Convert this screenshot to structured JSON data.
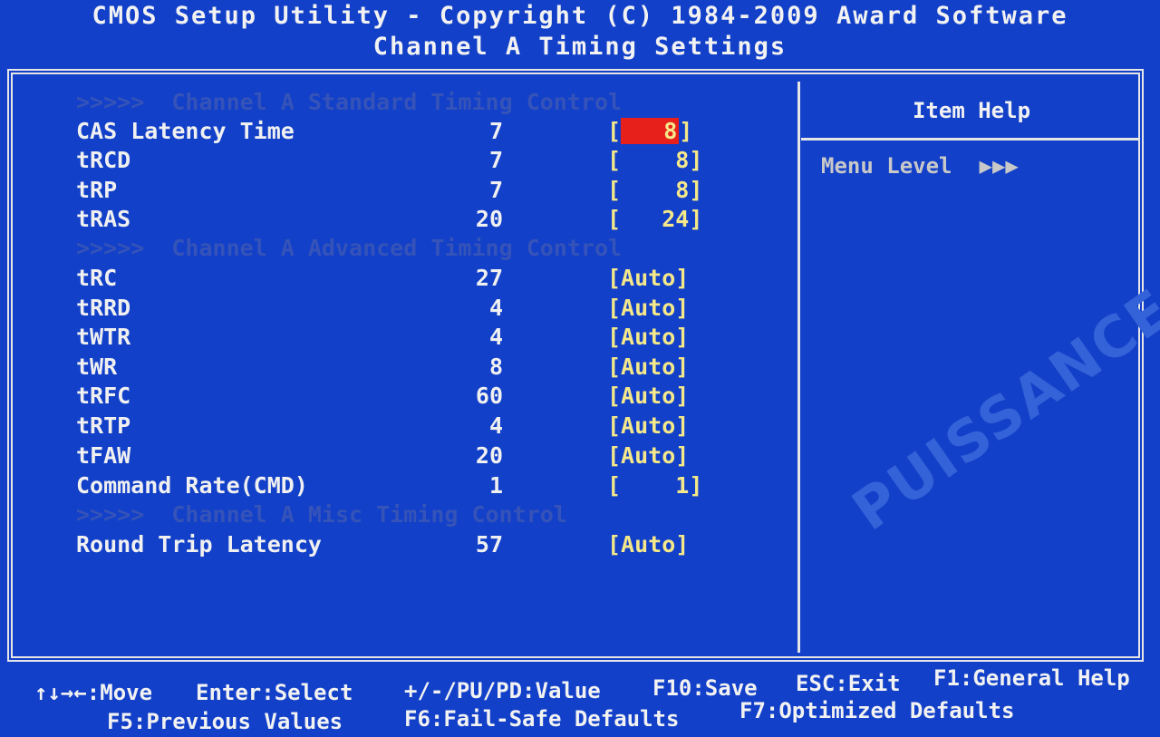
{
  "header": {
    "title": "CMOS Setup Utility - Copyright (C) 1984-2009 Award Software",
    "subtitle": "Channel A Timing Settings"
  },
  "sections": {
    "standard": ">>>>>  Channel A Standard Timing Control",
    "advanced": ">>>>>  Channel A Advanced Timing Control",
    "misc": ">>>>>  Channel A Misc Timing Control"
  },
  "rows": [
    {
      "label": "CAS Latency Time",
      "current": "7",
      "setting": "8",
      "open": "[",
      "close": "]"
    },
    {
      "label": "tRCD",
      "current": "7",
      "setting": "8",
      "open": "[",
      "close": "]"
    },
    {
      "label": "tRP",
      "current": "7",
      "setting": "8",
      "open": "[",
      "close": "]"
    },
    {
      "label": "tRAS",
      "current": "20",
      "setting": "24",
      "open": "[",
      "close": "]"
    },
    {
      "label": "tRC",
      "current": "27",
      "setting": "[Auto]"
    },
    {
      "label": "tRRD",
      "current": "4",
      "setting": "[Auto]"
    },
    {
      "label": "tWTR",
      "current": "4",
      "setting": "[Auto]"
    },
    {
      "label": "tWR",
      "current": "8",
      "setting": "[Auto]"
    },
    {
      "label": "tRFC",
      "current": "60",
      "setting": "[Auto]"
    },
    {
      "label": "tRTP",
      "current": "4",
      "setting": "[Auto]"
    },
    {
      "label": "tFAW",
      "current": "20",
      "setting": "[Auto]"
    },
    {
      "label": "Command Rate(CMD)",
      "current": "1",
      "setting": "1",
      "open": "[",
      "close": "]"
    },
    {
      "label": "Round Trip Latency",
      "current": "57",
      "setting": "[Auto]"
    }
  ],
  "help": {
    "title": "Item Help",
    "menu_level_label": "Menu Level",
    "menu_level_arrows": "▶▶▶"
  },
  "footer": {
    "move": "↑↓→←:Move",
    "enter": "Enter:Select",
    "value": "+/-/PU/PD:Value",
    "save": "F10:Save",
    "exit": "ESC:Exit",
    "help": "F1:General Help",
    "prev": "F5:Previous Values",
    "failsafe": "F6:Fail-Safe Defaults",
    "optimized": "F7:Optimized Defaults"
  },
  "watermark": "PUISSANCE-PC",
  "colors": {
    "background": "#1240c8",
    "highlight": "#e8201c",
    "setting_text": "#f5e88a",
    "disabled_text": "#3553b8"
  }
}
